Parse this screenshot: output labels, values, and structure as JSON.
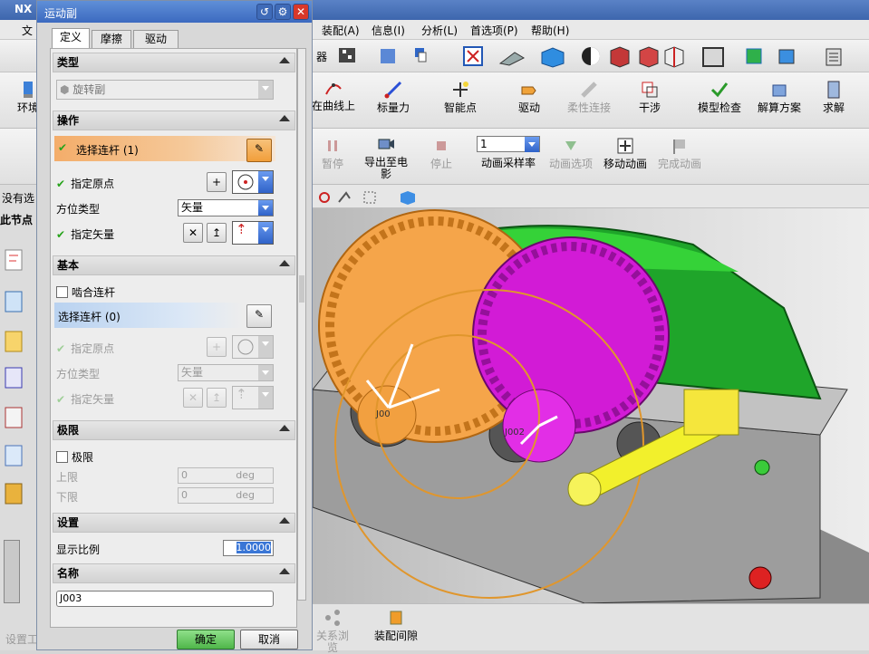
{
  "app": {
    "title": "NX"
  },
  "menubar": {
    "file": "文",
    "items": [
      "装配(A)",
      "信息(I)",
      "分析(L)",
      "首选项(P)",
      "帮助(H)"
    ]
  },
  "toolbar1": {
    "selector_tail": "器"
  },
  "toolbar2": {
    "left_label": "环境",
    "items": [
      "在曲线上",
      "标量力",
      "智能点",
      "驱动",
      "柔性连接",
      "干涉",
      "模型检查",
      "解算方案",
      "求解"
    ]
  },
  "toolbar3": {
    "items": [
      "暂停",
      "导出至电影",
      "停止",
      "动画采样率",
      "动画选项",
      "移动动画",
      "完成动画"
    ],
    "sample_rate_value": "1"
  },
  "left_panel": {
    "status_text": "没有选",
    "node_label": "此节点"
  },
  "bottom_bar": {
    "items": [
      "设置工",
      "关系浏览",
      "装配间隙"
    ]
  },
  "dialog": {
    "title": "运动副",
    "tabs": [
      "定义",
      "摩擦",
      "驱动"
    ],
    "type_section": {
      "header": "类型",
      "value": "旋转副"
    },
    "action_section": {
      "header": "操作",
      "select_link": "选择连杆 (1)",
      "origin": "指定原点",
      "orient_label": "方位类型",
      "orient_value": "矢量",
      "vector": "指定矢量"
    },
    "base_section": {
      "header": "基本",
      "mesh_checkbox": "啮合连杆",
      "select_link": "选择连杆 (0)",
      "origin": "指定原点",
      "orient_label": "方位类型",
      "orient_value": "矢量",
      "vector": "指定矢量"
    },
    "limit_section": {
      "header": "极限",
      "checkbox": "极限",
      "upper_label": "上限",
      "upper_value": "0",
      "lower_label": "下限",
      "lower_value": "0",
      "unit": "deg"
    },
    "settings_section": {
      "header": "设置",
      "scale_label": "显示比例",
      "scale_value": "1.0000"
    },
    "name_section": {
      "header": "名称",
      "value": "J003"
    },
    "ok": "确定",
    "cancel": "取消"
  },
  "scene": {
    "labels": [
      "J00",
      "J002"
    ]
  },
  "colors": {
    "gear_orange": "#f5a54a",
    "gear_magenta": "#d21bd6",
    "housing_green": "#2ecb2a",
    "shaft_yellow": "#f2f02c"
  }
}
